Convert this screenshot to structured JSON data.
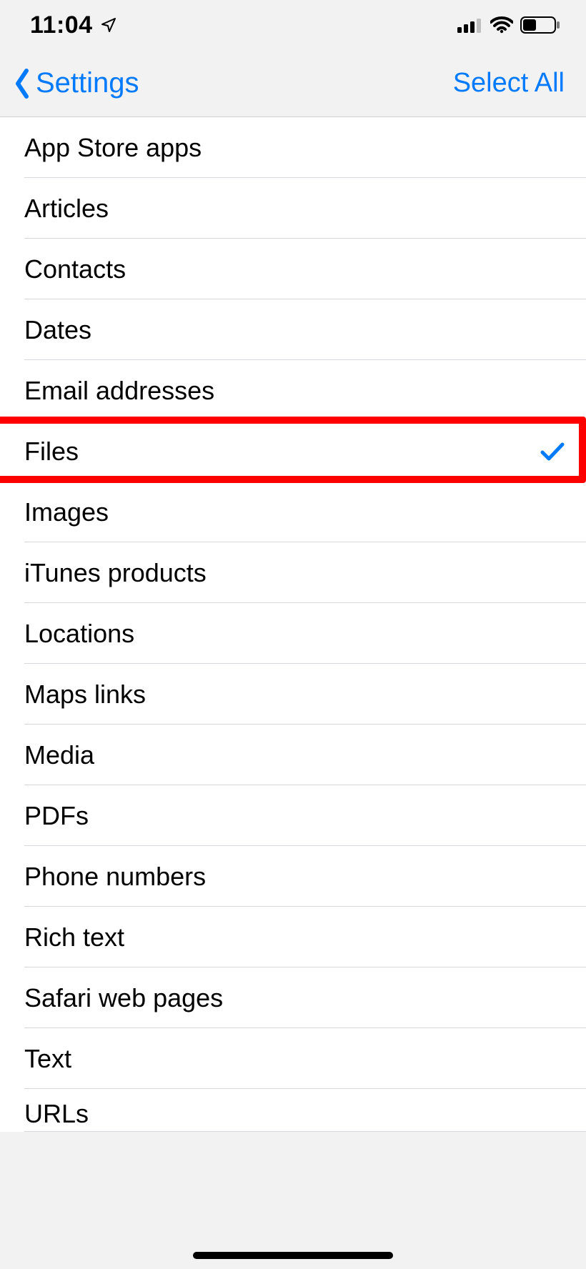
{
  "status": {
    "time": "11:04",
    "location_icon": "location-arrow-icon",
    "signal_icon": "cellular-signal-icon",
    "wifi_icon": "wifi-icon",
    "battery_icon": "battery-icon"
  },
  "nav": {
    "back_label": "Settings",
    "back_icon": "chevron-left-icon",
    "action_label": "Select All"
  },
  "items": [
    {
      "label": "App Store apps",
      "checked": false
    },
    {
      "label": "Articles",
      "checked": false
    },
    {
      "label": "Contacts",
      "checked": false
    },
    {
      "label": "Dates",
      "checked": false
    },
    {
      "label": "Email addresses",
      "checked": false
    },
    {
      "label": "Files",
      "checked": true,
      "highlighted": true
    },
    {
      "label": "Images",
      "checked": false
    },
    {
      "label": "iTunes products",
      "checked": false
    },
    {
      "label": "Locations",
      "checked": false
    },
    {
      "label": "Maps links",
      "checked": false
    },
    {
      "label": "Media",
      "checked": false
    },
    {
      "label": "PDFs",
      "checked": false
    },
    {
      "label": "Phone numbers",
      "checked": false
    },
    {
      "label": "Rich text",
      "checked": false
    },
    {
      "label": "Safari web pages",
      "checked": false
    },
    {
      "label": "Text",
      "checked": false
    },
    {
      "label": "URLs",
      "checked": false,
      "partial": true
    }
  ],
  "colors": {
    "accent": "#007aff",
    "highlight": "#ff0000"
  }
}
